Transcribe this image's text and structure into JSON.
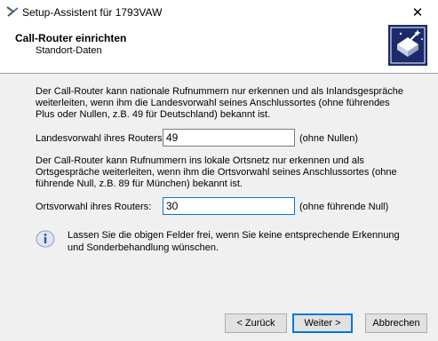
{
  "window": {
    "title": "Setup-Assistent für 1793VAW",
    "close_glyph": "✕"
  },
  "header": {
    "title": "Call-Router einrichten",
    "subtitle": "Standort-Daten",
    "icon": "wizard-wand-icon"
  },
  "country_section": {
    "description": "Der Call-Router kann nationale Rufnummern nur erkennen und als Inlandsgespräche weiterleiten, wenn ihm die Landesvorwahl seines Anschlussortes (ohne führendes Plus oder Nullen, z.B. 49 für Deutschland) bekannt ist.",
    "label": "Landesvorwahl ihres Routers:",
    "value": "49",
    "hint": "(ohne Nullen)"
  },
  "area_section": {
    "description": "Der Call-Router kann Rufnummern ins lokale Ortsnetz nur erkennen und als Ortsgespräche weiterleiten, wenn ihm die Ortsvorwahl seines Anschlussortes (ohne führende Null, z.B. 89 für München) bekannt ist.",
    "label": "Ortsvorwahl ihres Routers:",
    "value": "30",
    "hint": "(ohne führende Null)"
  },
  "info": {
    "icon": "info-icon",
    "text": "Lassen Sie die obigen Felder frei, wenn Sie keine entsprechende Erkennung und Sonderbehandlung wünschen."
  },
  "buttons": {
    "back": "< Zurück",
    "next": "Weiter >",
    "cancel": "Abbrechen"
  },
  "colors": {
    "accent": "#0078d7",
    "icon_bg": "#1b2a6b"
  }
}
